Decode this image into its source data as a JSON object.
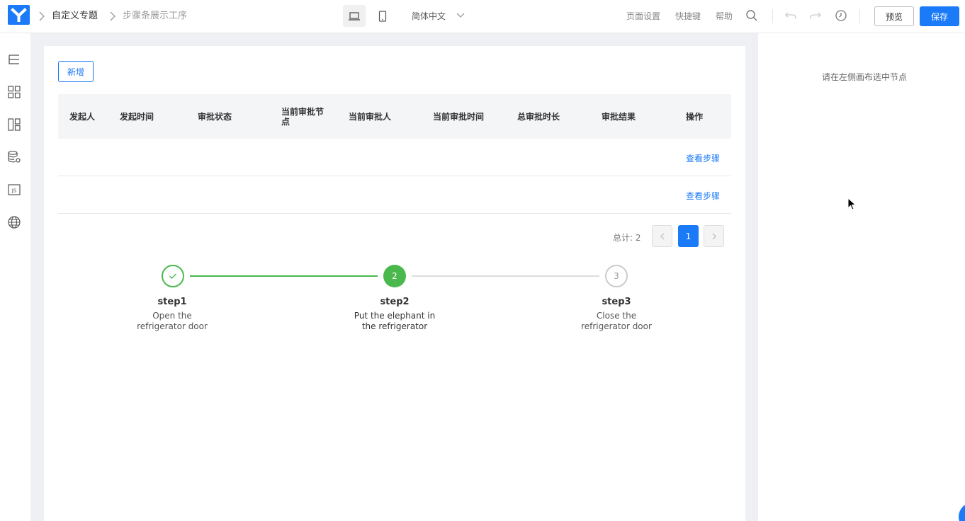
{
  "header": {
    "breadcrumb_main": "自定义专题",
    "breadcrumb_sub": "步骤条展示工序",
    "language": "简体中文",
    "links": {
      "page_settings": "页面设置",
      "shortcuts": "快捷键",
      "help": "帮助"
    },
    "preview_label": "预览",
    "save_label": "保存"
  },
  "toolbar": {
    "add_label": "新增"
  },
  "table": {
    "columns": [
      "发起人",
      "发起时间",
      "审批状态",
      "当前审批节点",
      "当前审批人",
      "当前审批时间",
      "总审批时长",
      "审批结果",
      "操作"
    ],
    "rows": [
      {
        "action": "查看步骤"
      },
      {
        "action": "查看步骤"
      }
    ]
  },
  "pagination": {
    "total_text": "总计: 2",
    "current_page": "1"
  },
  "steps": [
    {
      "title": "step1",
      "description": "Open the refrigerator door",
      "status": "finished"
    },
    {
      "title": "step2",
      "number": "2",
      "description": "Put the elephant in the refrigerator",
      "status": "process"
    },
    {
      "title": "step3",
      "number": "3",
      "description": "Close the refrigerator door",
      "status": "wait"
    }
  ],
  "right_panel": {
    "tip": "请在左侧画布选中节点"
  },
  "colors": {
    "primary": "#1a7af8",
    "success": "#4bb84e"
  }
}
